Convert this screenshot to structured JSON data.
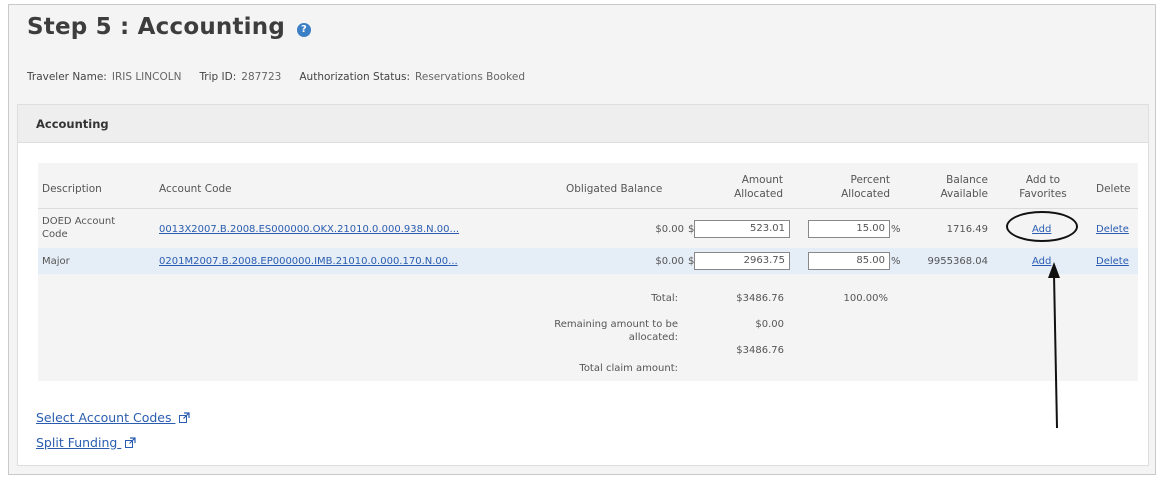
{
  "header": {
    "title": "Step 5 : Accounting",
    "help_icon": "help-icon"
  },
  "meta": {
    "traveler_label": "Traveler Name:",
    "traveler_value": "IRIS LINCOLN",
    "trip_label": "Trip ID:",
    "trip_value": "287723",
    "status_label": "Authorization Status:",
    "status_value": "Reservations Booked"
  },
  "section": {
    "title": "Accounting"
  },
  "table": {
    "headers": {
      "description": "Description",
      "account_code": "Account Code",
      "obligated": "Obligated Balance",
      "amount_l1": "Amount",
      "amount_l2": "Allocated",
      "percent_l1": "Percent",
      "percent_l2": "Allocated",
      "balance_l1": "Balance",
      "balance_l2": "Available",
      "favorites_l1": "Add to",
      "favorites_l2": "Favorites",
      "delete": "Delete"
    },
    "rows": [
      {
        "description_l1": "DOED Account",
        "description_l2": "Code",
        "account_code": "0013X2007.B.2008.ES000000.OKX.21010.0.000.938.N.00...",
        "obligated": "$0.00",
        "currency": "$",
        "amount": "523.01",
        "percent": "15.00",
        "percent_sign": "%",
        "balance": "1716.49",
        "add_label": "Add",
        "delete_label": "Delete"
      },
      {
        "description_l1": "Major",
        "account_code": "0201M2007.B.2008.EP000000.IMB.21010.0.000.170.N.00...",
        "obligated": "$0.00",
        "currency": "$",
        "amount": "2963.75",
        "percent": "85.00",
        "percent_sign": "%",
        "balance": "9955368.04",
        "add_label": "Add",
        "delete_label": "Delete"
      }
    ],
    "totals": {
      "total_label": "Total:",
      "total_amount": "$3486.76",
      "total_percent": "100.00%",
      "remaining_label_l1": "Remaining amount to be",
      "remaining_label_l2": "allocated:",
      "remaining_amount": "$0.00",
      "claim_label": "Total claim amount:",
      "claim_amount": "$3486.76"
    }
  },
  "links": {
    "select_account_codes": "Select Account Codes",
    "split_funding": "Split Funding",
    "external_icon": "external-link-icon"
  }
}
